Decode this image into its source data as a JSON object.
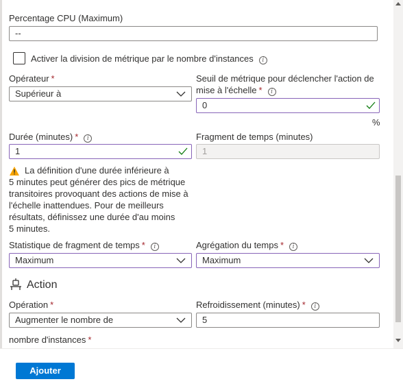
{
  "cpu": {
    "label": "Percentage CPU (Maximum)",
    "value": "--"
  },
  "divide_checkbox": {
    "label": "Activer la division de métrique par le nombre d'instances",
    "checked": false
  },
  "operator": {
    "label": "Opérateur",
    "value": "Supérieur à"
  },
  "threshold": {
    "label_line1": "Seuil de métrique pour déclencher l'action de",
    "label_line2": "mise à l'échelle",
    "value": "0",
    "unit": "%"
  },
  "duration": {
    "label": "Durée (minutes)",
    "value": "1"
  },
  "time_grain": {
    "label": "Fragment de temps (minutes)",
    "value": "1"
  },
  "warning": {
    "lines": [
      "La définition d'une durée inférieure à",
      "5 minutes peut générer des pics de métrique",
      "transitoires provoquant des actions de mise à",
      "l'échelle inattendues. Pour de meilleurs",
      "résultats, définissez une durée d'au moins",
      "5 minutes."
    ]
  },
  "time_grain_statistic": {
    "label": "Statistique de fragment de temps",
    "value": "Maximum"
  },
  "time_aggregation": {
    "label": "Agrégation du temps",
    "value": "Maximum"
  },
  "action": {
    "title": "Action"
  },
  "operation": {
    "label": "Opération",
    "value": "Augmenter le nombre de"
  },
  "cooldown": {
    "label": "Refroidissement (minutes)",
    "value": "5"
  },
  "instance_count": {
    "label": "nombre d'instances"
  },
  "footer": {
    "add_label": "Ajouter"
  },
  "colors": {
    "accent": "#0078d4",
    "valid": "#8764b8",
    "required": "#a4262c",
    "check": "#107c10",
    "warning": "#f7a400"
  }
}
